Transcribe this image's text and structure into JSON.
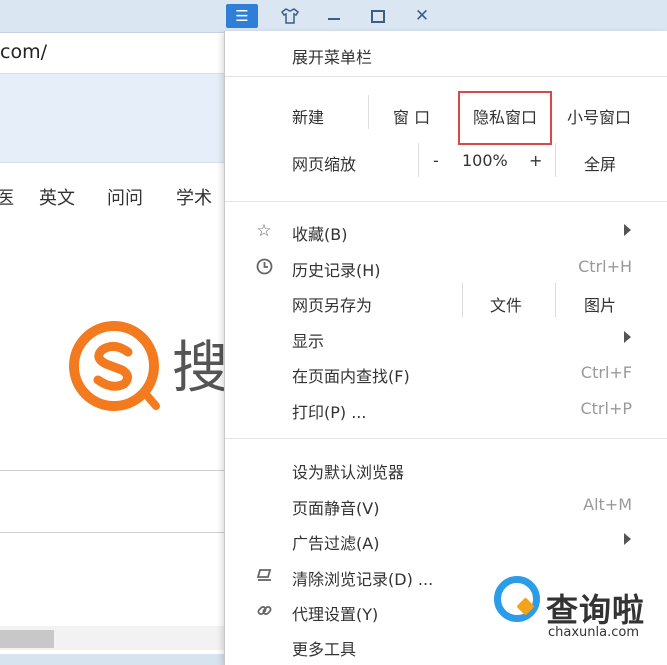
{
  "browser": {
    "url_fragment": "com/",
    "nav_links": [
      "医",
      "英文",
      "问问",
      "学术"
    ],
    "logo_char": "搜"
  },
  "menu": {
    "expand_menubar": "展开菜单栏",
    "new_label": "新建",
    "new_window": "窗 口",
    "incognito_window": "隐私窗口",
    "small_window": "小号窗口",
    "zoom_label": "网页缩放",
    "zoom_minus": "-",
    "zoom_value": "100%",
    "zoom_plus": "+",
    "fullscreen": "全屏",
    "favorites": "收藏(B)",
    "history": "历史记录(H)",
    "history_shortcut": "Ctrl+H",
    "save_page_as": "网页另存为",
    "save_file": "文件",
    "save_image": "图片",
    "display": "显示",
    "find_in_page": "在页面内查找(F)",
    "find_shortcut": "Ctrl+F",
    "print": "打印(P) ...",
    "print_shortcut": "Ctrl+P",
    "set_default": "设为默认浏览器",
    "mute_page": "页面静音(V)",
    "mute_shortcut": "Alt+M",
    "ad_filter": "广告过滤(A)",
    "clear_history": "清除浏览记录(D) ...",
    "proxy_settings": "代理设置(Y)",
    "more_tools": "更多工具"
  },
  "watermark": {
    "title": "查询啦",
    "subtitle": "chaxunla.com"
  },
  "icons": {
    "menu": "hamburger-icon",
    "skin": "shirt-icon",
    "minimize": "minimize-icon",
    "maximize": "maximize-icon",
    "close": "close-icon"
  },
  "colors": {
    "highlight_box": "#d9474a",
    "menu_button": "#2f7fd8",
    "watermark_blue": "#2b9ce8",
    "watermark_orange": "#f3a21b",
    "sogou_orange": "#f37a1f"
  }
}
